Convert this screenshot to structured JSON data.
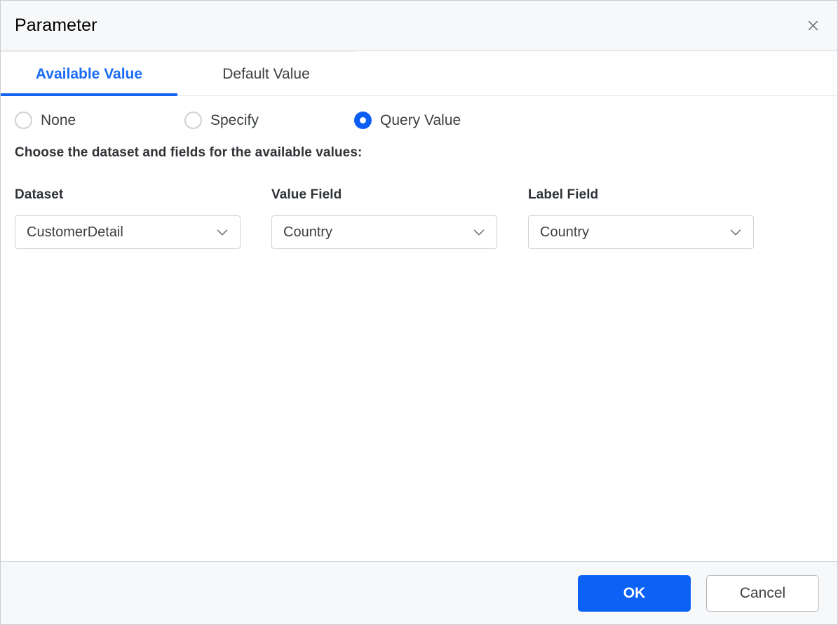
{
  "dialog": {
    "title": "Parameter",
    "close_icon": "close-icon"
  },
  "tabs": [
    {
      "label": "Available Value",
      "active": true
    },
    {
      "label": "Default Value",
      "active": false
    }
  ],
  "available_value": {
    "radio_group": {
      "options": [
        {
          "label": "None",
          "selected": false
        },
        {
          "label": "Specify",
          "selected": false
        },
        {
          "label": "Query Value",
          "selected": true
        }
      ],
      "selected": "Query Value"
    },
    "instruction": "Choose the dataset and fields for the available values:",
    "fields": [
      {
        "label": "Dataset",
        "value": "CustomerDetail",
        "icon": "chevron-down-icon"
      },
      {
        "label": "Value Field",
        "value": "Country",
        "icon": "chevron-down-icon"
      },
      {
        "label": "Label Field",
        "value": "Country",
        "icon": "chevron-down-icon"
      }
    ]
  },
  "footer": {
    "ok_label": "OK",
    "cancel_label": "Cancel"
  },
  "colors": {
    "accent_blue": "#0b62f4",
    "tab_active_blue": "#1a6cf5",
    "header_bg": "#f7f8f9",
    "border": "#cfd2d5"
  }
}
